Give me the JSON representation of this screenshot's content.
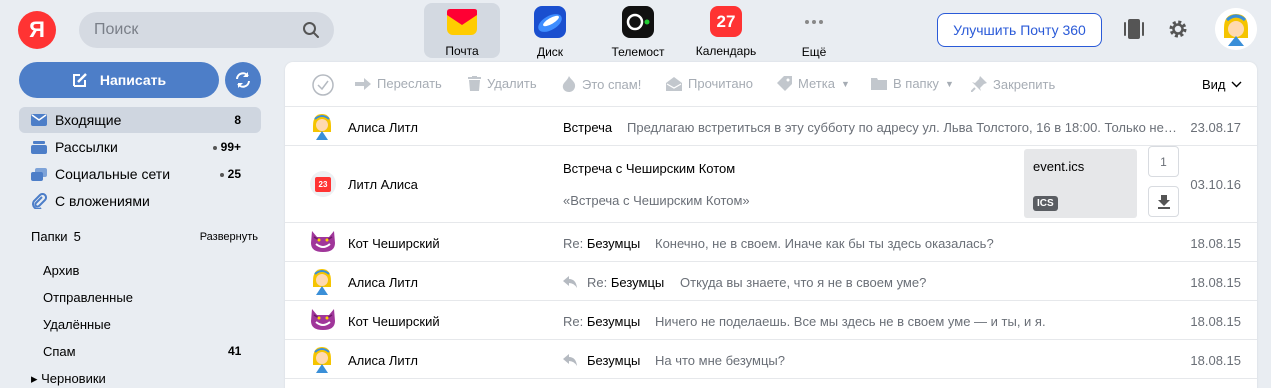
{
  "header": {
    "logo": "Я",
    "search_placeholder": "Поиск",
    "services": [
      {
        "label": "Почта",
        "icon": "mail-envelope-icon"
      },
      {
        "label": "Диск",
        "icon": "disk-icon"
      },
      {
        "label": "Телемост",
        "icon": "telemost-camera-icon"
      },
      {
        "label": "Календарь",
        "icon": "calendar-icon",
        "badge": "27"
      },
      {
        "label": "Ещё",
        "icon": "more-dots-icon"
      }
    ],
    "upgrade_label": "Улучшить Почту 360",
    "accent": "#4d7ec8",
    "brand_red": "#ff3333"
  },
  "sidebar": {
    "compose_label": "Написать",
    "items": [
      {
        "label": "Входящие",
        "count": "8",
        "icon": "inbox-icon"
      },
      {
        "label": "Рассылки",
        "count": "99+",
        "icon": "newsletters-icon"
      },
      {
        "label": "Социальные сети",
        "count": "25",
        "icon": "social-icon"
      },
      {
        "label": "С вложениями",
        "count": "",
        "icon": "paperclip-icon"
      }
    ],
    "folders_label": "Папки",
    "folders_count": "5",
    "expand_label": "Развернуть",
    "folders": [
      {
        "label": "Архив",
        "count": ""
      },
      {
        "label": "Отправленные",
        "count": ""
      },
      {
        "label": "Удалённые",
        "count": ""
      },
      {
        "label": "Спам",
        "count": "41"
      },
      {
        "label": "▸ Черновики",
        "count": ""
      }
    ]
  },
  "toolbar": {
    "forward": "Переслать",
    "delete": "Удалить",
    "spam": "Это спам!",
    "read": "Прочитано",
    "label": "Метка",
    "to_folder": "В папку",
    "pin": "Закрепить",
    "view": "Вид"
  },
  "messages": [
    {
      "sender": "Алиса Литл",
      "re": "",
      "subject": "Встреча",
      "preview": "Предлагаю встретиться в эту субботу по адресу ул. Льва Толстого, 16 в 18:00. Только не опаздывайте!",
      "date": "23.08.17"
    },
    {
      "sender": "Литл Алиса",
      "re": "",
      "subject": "Встреча с Чеширским Котом",
      "preview": "«Встреча с Чеширским Котом»",
      "date": "03.10.16",
      "attachment": "event.ics",
      "attachment_type": "ICS",
      "attachment_count": "1",
      "calendar_day": "23"
    },
    {
      "sender": "Кот Чеширский",
      "re": "Re:",
      "subject": "Безумцы",
      "preview": "Конечно, не в своем. Иначе как бы ты здесь оказалась?",
      "date": "18.08.15"
    },
    {
      "sender": "Алиса Литл",
      "re": "Re:",
      "subject": "Безумцы",
      "preview": "Откуда вы знаете, что я не в своем уме?",
      "date": "18.08.15"
    },
    {
      "sender": "Кот Чеширский",
      "re": "Re:",
      "subject": "Безумцы",
      "preview": "Ничего не поделаешь. Все мы здесь не в своем уме — и ты, и я.",
      "date": "18.08.15"
    },
    {
      "sender": "Алиса Литл",
      "re": "",
      "subject": "Безумцы",
      "preview": "На что мне безумцы?",
      "date": "18.08.15"
    }
  ]
}
